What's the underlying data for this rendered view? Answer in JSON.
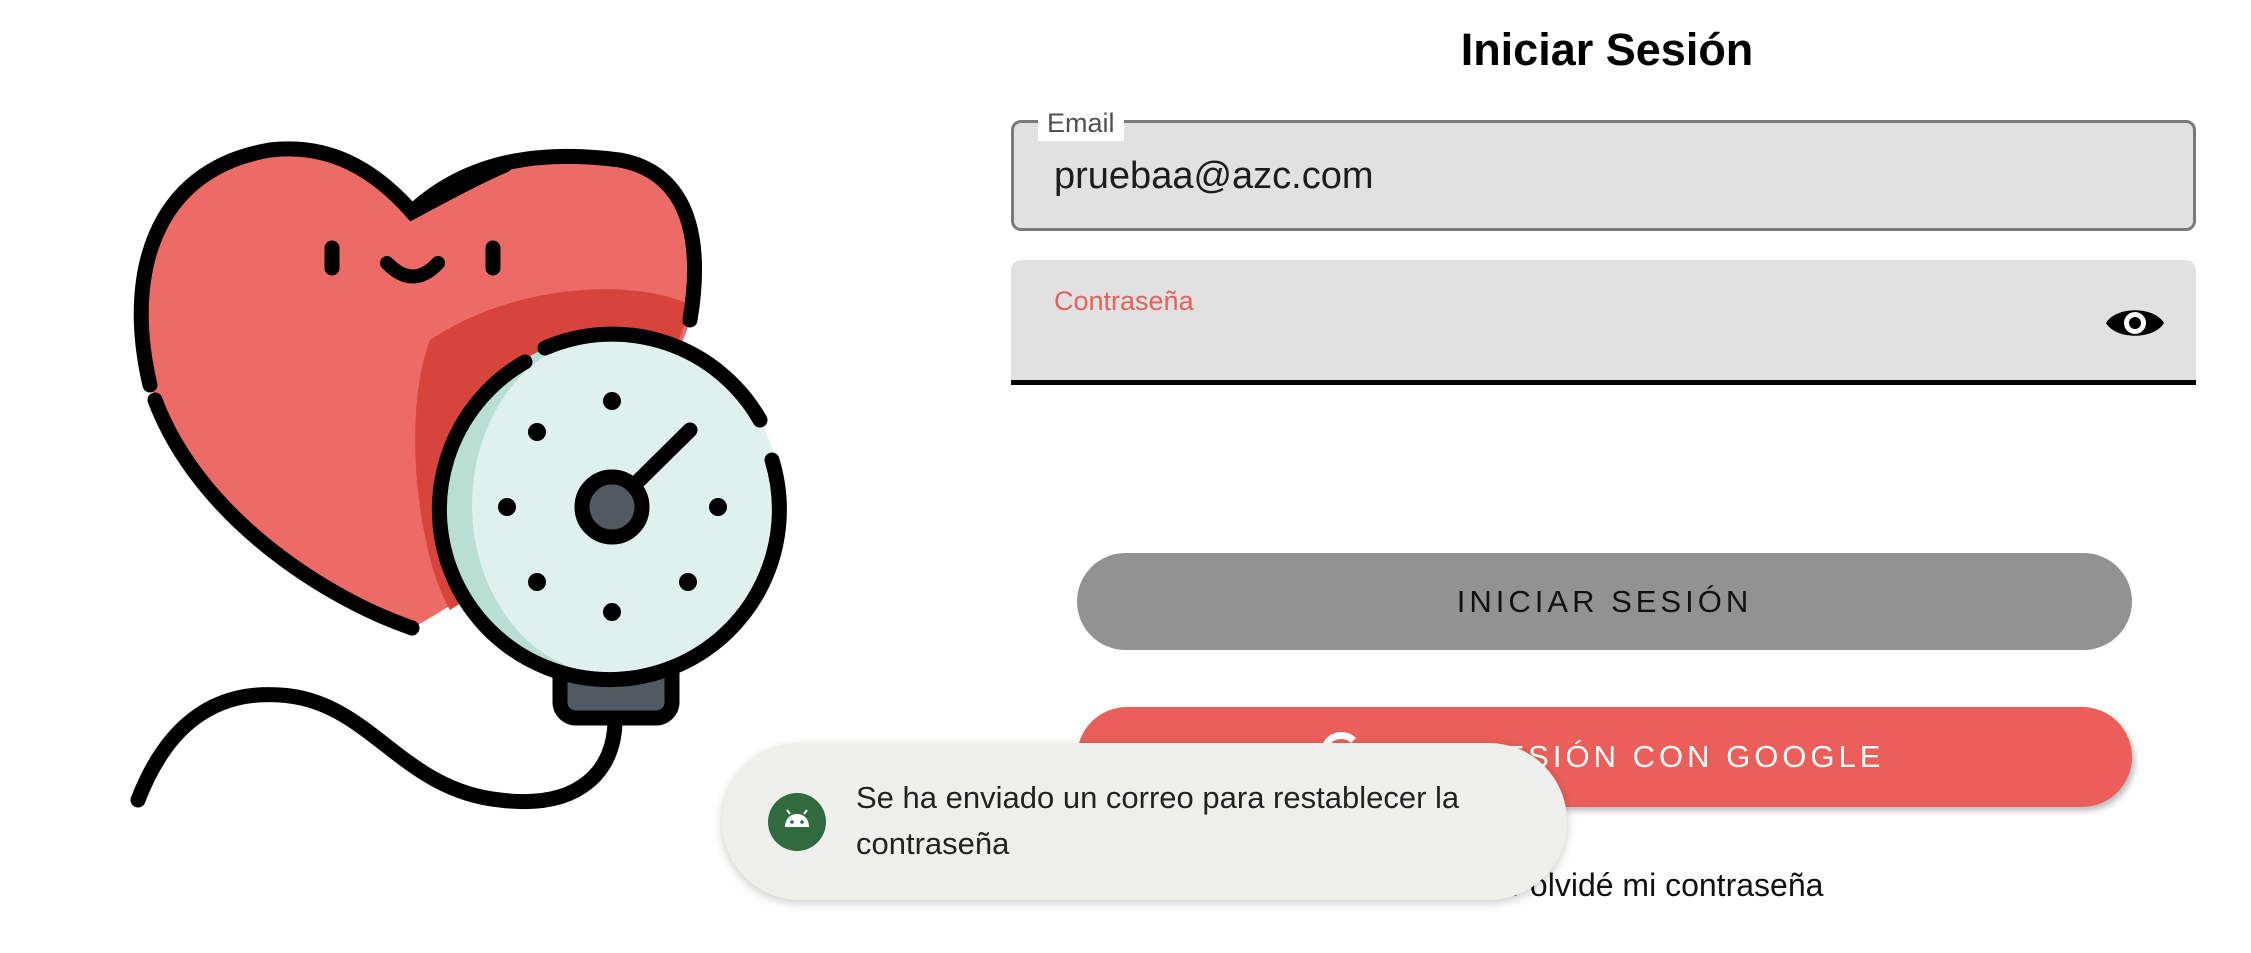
{
  "screen": {
    "title": "Iniciar Sesión"
  },
  "form": {
    "email_label": "Email",
    "email_value": "pruebaa@azc.com",
    "password_label": "Contraseña",
    "password_value": "",
    "password_visibility_icon": "eye-icon"
  },
  "buttons": {
    "login_label": "INICIAR SESIÓN",
    "google_label": "INICIAR SESIÓN CON GOOGLE",
    "google_icon": "google-g-icon",
    "forgot_password": "Me olvidé mi contraseña"
  },
  "toast": {
    "icon": "android-icon",
    "message": "Se ha enviado un correo para restablecer la contraseña"
  },
  "illustration": {
    "name": "heart-blood-pressure-gauge",
    "colors": {
      "heart": "#ec6b66",
      "heart_shadow": "#d6443b",
      "gauge_face": "#dff1ec",
      "gauge_shadow": "#b9dfd3",
      "outline": "#000000"
    }
  },
  "colors": {
    "accent": "#ea5f59",
    "login_button": "#939292",
    "field_background": "#e1e1e1"
  }
}
